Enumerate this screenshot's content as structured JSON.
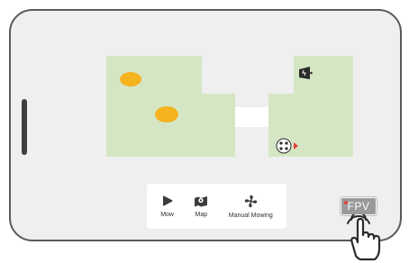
{
  "actions": [
    {
      "label": "Mow",
      "icon": "play-icon"
    },
    {
      "label": "Map",
      "icon": "map-pin-icon"
    },
    {
      "label": "Manual Mowing",
      "icon": "fan-blade-icon"
    }
  ],
  "fpv": {
    "label": "FPV",
    "icon": "pointing-hand-icon"
  },
  "map": {
    "zone_color": "#d5e6c4",
    "no_go_color": "#f6b320",
    "mower_indicator_color": "#e0443a"
  }
}
